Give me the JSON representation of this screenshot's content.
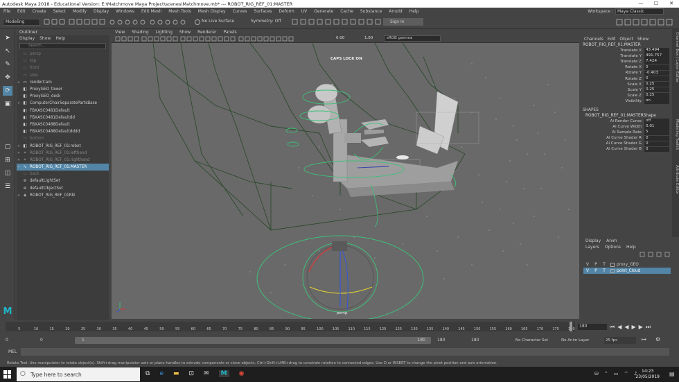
{
  "titlebar": {
    "title": "Autodesk Maya 2018 - Educational Version: E:\\Matchmove Maya Project\\scenes\\Matchmove.mb*   ---   ROBOT_RIG_REF_01:MASTER",
    "min": "—",
    "max": "☐",
    "close": "✕"
  },
  "menus": [
    "File",
    "Edit",
    "Create",
    "Select",
    "Modify",
    "Display",
    "Windows",
    "Edit Mesh",
    "Mesh Tools",
    "Mesh Display",
    "Curves",
    "Surfaces",
    "Deform",
    "UV",
    "Generate",
    "Cache",
    "Substance",
    "Arnold",
    "Help"
  ],
  "workspace": {
    "label": "Workspace :",
    "value": "Maya Classic"
  },
  "shelf": {
    "mode": "Modeling",
    "live_surface": "No Live Surface",
    "symmetry": "Symmetry: Off",
    "sign_in": "Sign In"
  },
  "outliner": {
    "title": "Outliner",
    "menu": [
      "Display",
      "Show",
      "Help"
    ],
    "search_placeholder": "Search...",
    "items": [
      {
        "label": "persp",
        "style": "dim",
        "icon": "camera-icon",
        "exp": ""
      },
      {
        "label": "top",
        "style": "dim",
        "icon": "camera-icon",
        "exp": ""
      },
      {
        "label": "front",
        "style": "dim",
        "icon": "camera-icon",
        "exp": ""
      },
      {
        "label": "side",
        "style": "dim",
        "icon": "camera-icon",
        "exp": ""
      },
      {
        "label": "renderCam",
        "style": "",
        "icon": "camera-icon",
        "exp": "+"
      },
      {
        "label": "ProxyGEO_tower",
        "style": "",
        "icon": "mesh-icon",
        "exp": ""
      },
      {
        "label": "ProxyGEO_desk",
        "style": "",
        "icon": "mesh-icon",
        "exp": ""
      },
      {
        "label": "ComputerChairSeparatePartsBase",
        "style": "",
        "icon": "mesh-icon",
        "exp": "+"
      },
      {
        "label": "FBXASC0481Default",
        "style": "",
        "icon": "mesh-icon",
        "exp": ""
      },
      {
        "label": "FBXASC0481Defaultdd",
        "style": "",
        "icon": "mesh-icon",
        "exp": ""
      },
      {
        "label": "FBXASC0488Default",
        "style": "",
        "icon": "mesh-icon",
        "exp": ""
      },
      {
        "label": "FBXASC0488Defaultdddd",
        "style": "",
        "icon": "mesh-icon",
        "exp": ""
      },
      {
        "label": "bottom",
        "style": "dim",
        "icon": "camera-icon",
        "exp": ""
      },
      {
        "label": "ROBOT_RIG_REF_01:robot",
        "style": "",
        "icon": "mesh-icon",
        "exp": "+"
      },
      {
        "label": "ROBOT_RIG_REF_01:lefthand",
        "style": "grey",
        "icon": "joint-icon",
        "exp": "+"
      },
      {
        "label": "ROBOT_RIG_REF_01:righthand",
        "style": "grey",
        "icon": "joint-icon",
        "exp": "+"
      },
      {
        "label": "ROBOT_RIG_REF_01:MASTER",
        "style": "hl",
        "icon": "curve-icon",
        "exp": "+"
      },
      {
        "label": "back",
        "style": "dim",
        "icon": "camera-icon",
        "exp": ""
      },
      {
        "label": "defaultLightSet",
        "style": "",
        "icon": "set-icon",
        "exp": ""
      },
      {
        "label": "defaultObjectSet",
        "style": "",
        "icon": "set-icon",
        "exp": ""
      },
      {
        "label": "ROBOT_RIG_REF_01RN",
        "style": "",
        "icon": "reference-icon",
        "exp": "+"
      }
    ]
  },
  "viewport": {
    "menu": [
      "View",
      "Shading",
      "Lighting",
      "Show",
      "Renderer",
      "Panels"
    ],
    "exposure": "0.00",
    "gamma": "1.00",
    "color_space": "sRGB gamma",
    "caps": "CAPS LOCK ON",
    "camera": "persp"
  },
  "channelbox": {
    "menu": [
      "Channels",
      "Edit",
      "Object",
      "Show"
    ],
    "node": "ROBOT_RIG_REF_01:MASTER",
    "attrs": [
      {
        "n": "Translate X",
        "v": "43.494"
      },
      {
        "n": "Translate Y",
        "v": "491.757"
      },
      {
        "n": "Translate Z",
        "v": "7.424"
      },
      {
        "n": "Rotate X",
        "v": "0"
      },
      {
        "n": "Rotate Y",
        "v": "-0.403"
      },
      {
        "n": "Rotate Z",
        "v": "0"
      },
      {
        "n": "Scale X",
        "v": "0.25"
      },
      {
        "n": "Scale Y",
        "v": "0.25"
      },
      {
        "n": "Scale Z",
        "v": "0.25"
      },
      {
        "n": "Visibility",
        "v": "on"
      }
    ],
    "shapes_label": "SHAPES",
    "shape_node": "ROBOT_RIG_REF_01:MASTERShape",
    "shape_attrs": [
      {
        "n": "Ai Render Curve",
        "v": "off"
      },
      {
        "n": "Ai Curve Width",
        "v": "0.01"
      },
      {
        "n": "Ai Sample Rate",
        "v": "5"
      },
      {
        "n": "Ai Curve Shader R",
        "v": "0"
      },
      {
        "n": "Ai Curve Shader G",
        "v": "0"
      },
      {
        "n": "Ai Curve Shader B",
        "v": "0"
      }
    ]
  },
  "sidetabs": [
    "Channel Box / Layer Editor",
    "Modeling Toolkit",
    "Attribute Editor"
  ],
  "layers": {
    "tabs": [
      "Display",
      "Anim"
    ],
    "menu": [
      "Layers",
      "Options",
      "Help"
    ],
    "rows": [
      {
        "v": "V",
        "p": "P",
        "t": "T",
        "name": "proxy_GEO",
        "sel": false
      },
      {
        "v": "V",
        "p": "P",
        "t": "T",
        "name": "point_Cloud",
        "sel": true
      }
    ]
  },
  "time": {
    "ticks": [
      "5",
      "10",
      "15",
      "20",
      "25",
      "30",
      "35",
      "40",
      "45",
      "50",
      "55",
      "60",
      "65",
      "70",
      "75",
      "80",
      "85",
      "90",
      "95",
      "100",
      "105",
      "110",
      "115",
      "120",
      "125",
      "130",
      "135",
      "140",
      "145",
      "150",
      "155",
      "160",
      "165",
      "170",
      "175",
      "180"
    ],
    "current": "180",
    "range_start": "0",
    "anim_start": "0",
    "range_min": "1",
    "range_max": "180",
    "anim_end": "180",
    "end": "180",
    "character": "No Character Set",
    "anim_layer": "No Anim Layer",
    "fps": "25 fps"
  },
  "cmd": {
    "label": "MEL"
  },
  "help": "Rotate Tool: Use manipulator to rotate object(s). Shift+drag manipulator axis or plane handles to extrude components or clone objects. Ctrl+Shift+LMB+drag to constrain rotation to connected edges. Use D or INSERT to change the pivot position and axis orientation.",
  "taskbar": {
    "search": "Type here to search",
    "time": "14:23",
    "date": "23/05/2019"
  }
}
